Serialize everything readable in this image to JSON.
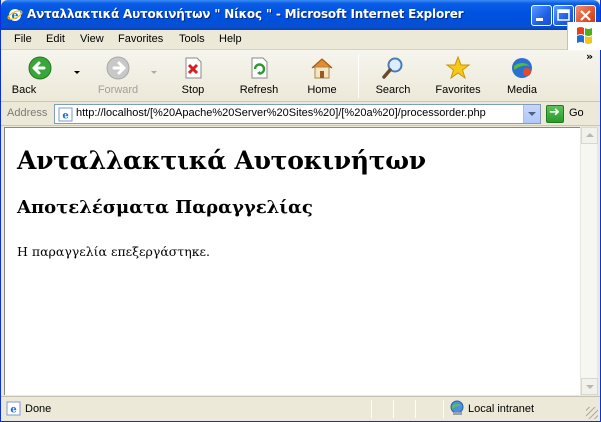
{
  "window": {
    "title": "Ανταλλακτικά Αυτοκινήτων \" Νίκος \" - Microsoft Internet Explorer"
  },
  "menu": {
    "items": [
      {
        "label": "File"
      },
      {
        "label": "Edit"
      },
      {
        "label": "View"
      },
      {
        "label": "Favorites"
      },
      {
        "label": "Tools"
      },
      {
        "label": "Help"
      }
    ]
  },
  "toolbar": {
    "back": {
      "label": "Back",
      "icon": "back-arrow-icon"
    },
    "forward": {
      "label": "Forward",
      "icon": "forward-arrow-icon",
      "enabled": false
    },
    "stop": {
      "label": "Stop",
      "icon": "stop-icon"
    },
    "refresh": {
      "label": "Refresh",
      "icon": "refresh-icon"
    },
    "home": {
      "label": "Home",
      "icon": "home-icon"
    },
    "search": {
      "label": "Search",
      "icon": "search-icon"
    },
    "favorites": {
      "label": "Favorites",
      "icon": "star-icon"
    },
    "media": {
      "label": "Media",
      "icon": "media-icon"
    },
    "more": "»"
  },
  "address": {
    "label": "Address",
    "url": "http://localhost/[%20Apache%20Server%20Sites%20]/[%20a%20]/processorder.php",
    "go_label": "Go"
  },
  "page": {
    "heading": "Ανταλλακτικά Αυτοκινήτων",
    "subheading": "Αποτελέσματα Παραγγελίας",
    "message": "Η παραγγελία επεξεργάστηκε."
  },
  "status": {
    "text": "Done",
    "zone": "Local intranet"
  },
  "colors": {
    "titlebar": "#0053e1",
    "chrome": "#ece9d8",
    "close": "#e3542d"
  }
}
